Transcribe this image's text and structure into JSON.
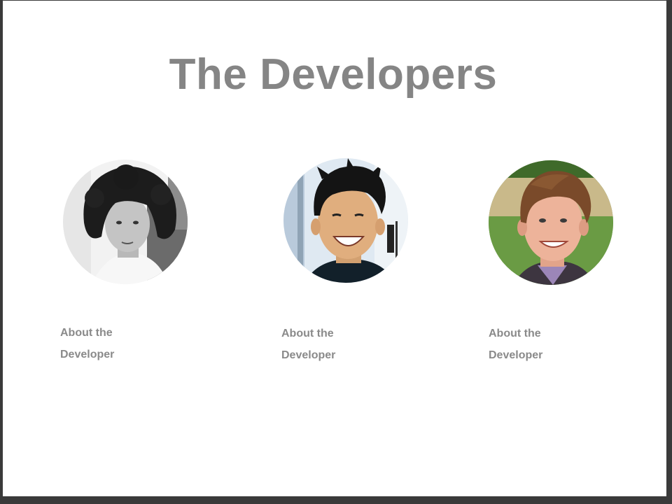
{
  "page": {
    "title": "The Developers"
  },
  "developers": [
    {
      "avatar_icon": "developer-portrait-bw",
      "about_line1": "About the",
      "about_line2": "Developer"
    },
    {
      "avatar_icon": "developer-portrait-color",
      "about_line1": "About the",
      "about_line2": "Developer"
    },
    {
      "avatar_icon": "developer-portrait-outdoor",
      "about_line1": "About the",
      "about_line2": "Developer"
    }
  ],
  "colors": {
    "title": "#858585",
    "link": "#8a8a8a",
    "background": "#ffffff",
    "frame_border": "#3a3a3a"
  }
}
